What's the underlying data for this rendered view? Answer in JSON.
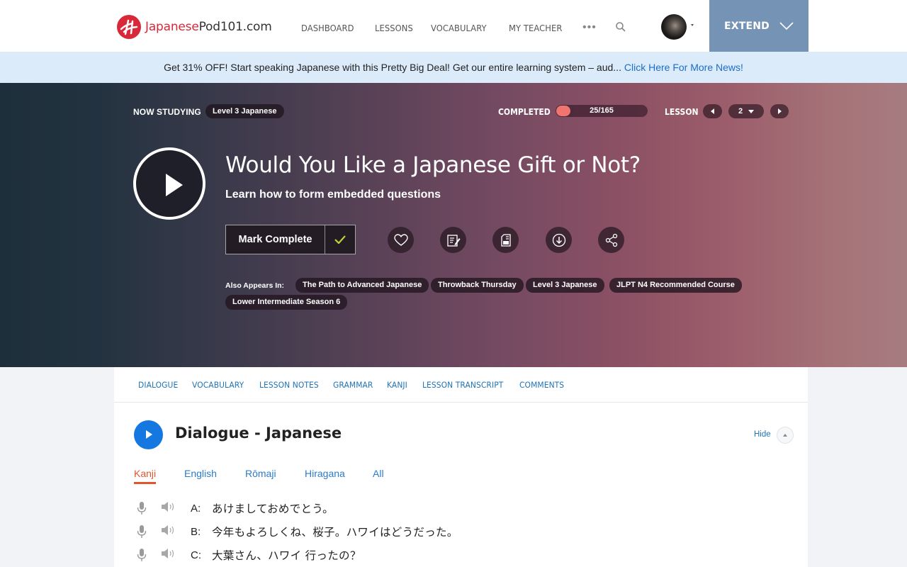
{
  "header": {
    "logo": {
      "part1": "Japanese",
      "part2": "Pod101.com"
    },
    "nav": [
      "DASHBOARD",
      "LESSONS",
      "VOCABULARY",
      "MY TEACHER"
    ],
    "more_icon": "more-dots-icon",
    "search_icon": "search-icon",
    "extend_label": "EXTEND",
    "brand_color": "#d8283a",
    "extend_color": "#7593b4"
  },
  "promo": {
    "text": "Get 31% OFF! Start speaking Japanese with this Pretty Big Deal! Get our entire learning system – aud... ",
    "link": "Click Here For More News!"
  },
  "hero": {
    "now_studying_label": "NOW STUDYING",
    "now_studying_value": "Level 3 Japanese",
    "completed_label": "COMPLETED",
    "completed_text": "25/165",
    "completed_fraction": 0.152,
    "lesson_label": "LESSON",
    "lesson_number": "2",
    "title": "Would You Like a Japanese Gift or Not?",
    "subtitle": "Learn how to form embedded questions",
    "mark_complete": "Mark Complete",
    "actions": [
      "heart-icon",
      "notes-icon",
      "pdf-icon",
      "download-icon",
      "share-icon"
    ],
    "also_appears_label": "Also Appears In:",
    "also_appears": [
      "The Path to Advanced Japanese",
      "Throwback Thursday",
      "Level 3 Japanese",
      "JLPT N4 Recommended Course",
      "Lower Intermediate Season 6"
    ]
  },
  "content": {
    "tabs": [
      "DIALOGUE",
      "VOCABULARY",
      "LESSON NOTES",
      "GRAMMAR",
      "KANJI",
      "LESSON TRANSCRIPT",
      "COMMENTS"
    ],
    "dialogue_title": "Dialogue - Japanese",
    "hide_label": "Hide",
    "sub_tabs": [
      "Kanji",
      "English",
      "Rōmaji",
      "Hiragana",
      "All"
    ],
    "active_sub_tab": "Kanji",
    "lines": [
      {
        "speaker": "A:",
        "text": "あけましておめでとう。"
      },
      {
        "speaker": "B:",
        "text": "今年もよろしくね、桜子。ハワイはどうだった。"
      },
      {
        "speaker": "C:",
        "text": "大葉さん、ハワイ 行ったの？"
      }
    ]
  }
}
